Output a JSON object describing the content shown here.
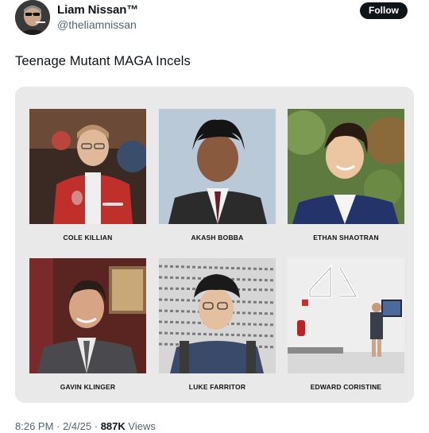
{
  "author": {
    "name": "Liam Nissan™",
    "handle": "@theliamnissan",
    "follow_label": "Follow"
  },
  "tweet": {
    "text": "Teenage Mutant MAGA Incels"
  },
  "people": [
    {
      "name": "COLE KILLIAN"
    },
    {
      "name": "AKASH BOBBA"
    },
    {
      "name": "ETHAN SHAOTRAN"
    },
    {
      "name": "GAVIN KLINGER"
    },
    {
      "name": "LUKE FARRITOR"
    },
    {
      "name": "EDWARD CORISTINE"
    }
  ],
  "meta": {
    "time": "8:26 PM",
    "sep1": " · ",
    "date": "2/4/25",
    "sep2": " · ",
    "views_count": "887K",
    "views_label": " Views"
  }
}
